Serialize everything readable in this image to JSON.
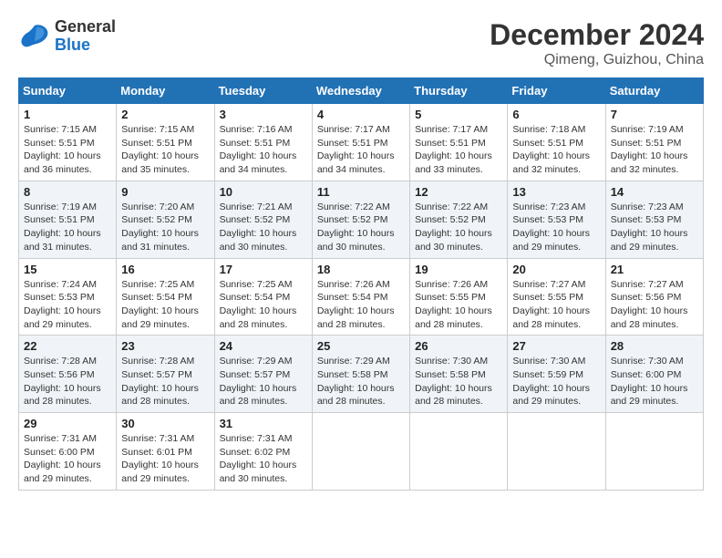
{
  "header": {
    "logo_line1": "General",
    "logo_line2": "Blue",
    "month": "December 2024",
    "location": "Qimeng, Guizhou, China"
  },
  "weekdays": [
    "Sunday",
    "Monday",
    "Tuesday",
    "Wednesday",
    "Thursday",
    "Friday",
    "Saturday"
  ],
  "weeks": [
    [
      {
        "day": "1",
        "sunrise": "7:15 AM",
        "sunset": "5:51 PM",
        "daylight": "10 hours and 36 minutes."
      },
      {
        "day": "2",
        "sunrise": "7:15 AM",
        "sunset": "5:51 PM",
        "daylight": "10 hours and 35 minutes."
      },
      {
        "day": "3",
        "sunrise": "7:16 AM",
        "sunset": "5:51 PM",
        "daylight": "10 hours and 34 minutes."
      },
      {
        "day": "4",
        "sunrise": "7:17 AM",
        "sunset": "5:51 PM",
        "daylight": "10 hours and 34 minutes."
      },
      {
        "day": "5",
        "sunrise": "7:17 AM",
        "sunset": "5:51 PM",
        "daylight": "10 hours and 33 minutes."
      },
      {
        "day": "6",
        "sunrise": "7:18 AM",
        "sunset": "5:51 PM",
        "daylight": "10 hours and 32 minutes."
      },
      {
        "day": "7",
        "sunrise": "7:19 AM",
        "sunset": "5:51 PM",
        "daylight": "10 hours and 32 minutes."
      }
    ],
    [
      {
        "day": "8",
        "sunrise": "7:19 AM",
        "sunset": "5:51 PM",
        "daylight": "10 hours and 31 minutes."
      },
      {
        "day": "9",
        "sunrise": "7:20 AM",
        "sunset": "5:52 PM",
        "daylight": "10 hours and 31 minutes."
      },
      {
        "day": "10",
        "sunrise": "7:21 AM",
        "sunset": "5:52 PM",
        "daylight": "10 hours and 30 minutes."
      },
      {
        "day": "11",
        "sunrise": "7:22 AM",
        "sunset": "5:52 PM",
        "daylight": "10 hours and 30 minutes."
      },
      {
        "day": "12",
        "sunrise": "7:22 AM",
        "sunset": "5:52 PM",
        "daylight": "10 hours and 30 minutes."
      },
      {
        "day": "13",
        "sunrise": "7:23 AM",
        "sunset": "5:53 PM",
        "daylight": "10 hours and 29 minutes."
      },
      {
        "day": "14",
        "sunrise": "7:23 AM",
        "sunset": "5:53 PM",
        "daylight": "10 hours and 29 minutes."
      }
    ],
    [
      {
        "day": "15",
        "sunrise": "7:24 AM",
        "sunset": "5:53 PM",
        "daylight": "10 hours and 29 minutes."
      },
      {
        "day": "16",
        "sunrise": "7:25 AM",
        "sunset": "5:54 PM",
        "daylight": "10 hours and 29 minutes."
      },
      {
        "day": "17",
        "sunrise": "7:25 AM",
        "sunset": "5:54 PM",
        "daylight": "10 hours and 28 minutes."
      },
      {
        "day": "18",
        "sunrise": "7:26 AM",
        "sunset": "5:54 PM",
        "daylight": "10 hours and 28 minutes."
      },
      {
        "day": "19",
        "sunrise": "7:26 AM",
        "sunset": "5:55 PM",
        "daylight": "10 hours and 28 minutes."
      },
      {
        "day": "20",
        "sunrise": "7:27 AM",
        "sunset": "5:55 PM",
        "daylight": "10 hours and 28 minutes."
      },
      {
        "day": "21",
        "sunrise": "7:27 AM",
        "sunset": "5:56 PM",
        "daylight": "10 hours and 28 minutes."
      }
    ],
    [
      {
        "day": "22",
        "sunrise": "7:28 AM",
        "sunset": "5:56 PM",
        "daylight": "10 hours and 28 minutes."
      },
      {
        "day": "23",
        "sunrise": "7:28 AM",
        "sunset": "5:57 PM",
        "daylight": "10 hours and 28 minutes."
      },
      {
        "day": "24",
        "sunrise": "7:29 AM",
        "sunset": "5:57 PM",
        "daylight": "10 hours and 28 minutes."
      },
      {
        "day": "25",
        "sunrise": "7:29 AM",
        "sunset": "5:58 PM",
        "daylight": "10 hours and 28 minutes."
      },
      {
        "day": "26",
        "sunrise": "7:30 AM",
        "sunset": "5:58 PM",
        "daylight": "10 hours and 28 minutes."
      },
      {
        "day": "27",
        "sunrise": "7:30 AM",
        "sunset": "5:59 PM",
        "daylight": "10 hours and 29 minutes."
      },
      {
        "day": "28",
        "sunrise": "7:30 AM",
        "sunset": "6:00 PM",
        "daylight": "10 hours and 29 minutes."
      }
    ],
    [
      {
        "day": "29",
        "sunrise": "7:31 AM",
        "sunset": "6:00 PM",
        "daylight": "10 hours and 29 minutes."
      },
      {
        "day": "30",
        "sunrise": "7:31 AM",
        "sunset": "6:01 PM",
        "daylight": "10 hours and 29 minutes."
      },
      {
        "day": "31",
        "sunrise": "7:31 AM",
        "sunset": "6:02 PM",
        "daylight": "10 hours and 30 minutes."
      },
      null,
      null,
      null,
      null
    ]
  ]
}
